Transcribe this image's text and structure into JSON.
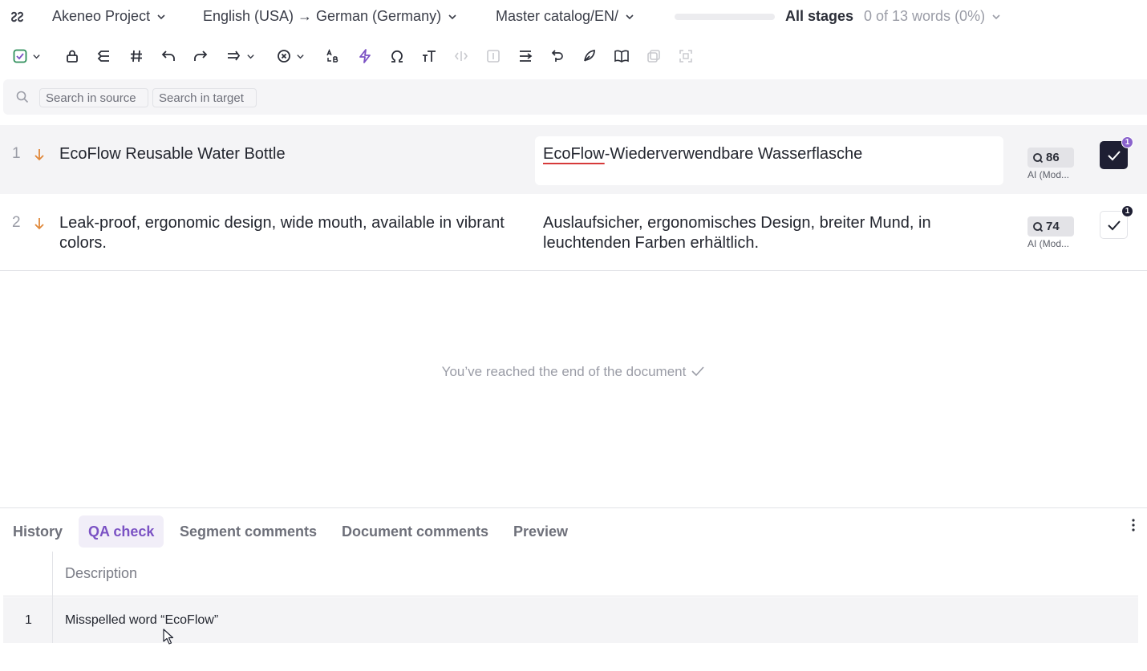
{
  "header": {
    "project": "Akeneo Project",
    "language_pair": "English (USA) → German (Germany)",
    "catalog": "Master catalog/EN/",
    "stages": "All stages",
    "word_progress": "0 of 13 words (0%)",
    "progress_fraction": 0
  },
  "search": {
    "source_placeholder": "Search in source",
    "target_placeholder": "Search in target"
  },
  "segments": [
    {
      "number": "1",
      "source": "EcoFlow Reusable Water Bottle",
      "target_misspelled": "EcoFlow",
      "target_rest": "-Wiederverwendbare Wasserflasche",
      "score": "86",
      "origin": "AI (Mod...",
      "confirmed": true,
      "badge": "1"
    },
    {
      "number": "2",
      "source": "Leak-proof, ergonomic design, wide mouth, available in vibrant colors.",
      "target": "Auslaufsicher, ergonomisches Design, breiter Mund, in leuchtenden Farben erhältlich.",
      "score": "74",
      "origin": "AI (Mod...",
      "confirmed": false,
      "badge": "1"
    }
  ],
  "end_message": "You’ve reached the end of the document",
  "panel": {
    "tabs": [
      {
        "label": "History",
        "active": false
      },
      {
        "label": "QA check",
        "active": true
      },
      {
        "label": "Segment comments",
        "active": false
      },
      {
        "label": "Document comments",
        "active": false
      },
      {
        "label": "Preview",
        "active": false
      }
    ],
    "qa_header": "Description",
    "qa_rows": [
      {
        "number": "1",
        "description": "Misspelled word “EcoFlow”"
      }
    ]
  },
  "colors": {
    "accent": "#7b52c4",
    "confirm_dark": "#1e1f33",
    "arrow_orange": "#e0883a",
    "spell_red": "#d63a3a"
  },
  "icons": {
    "toolbar": [
      "confirm-icon",
      "lock-icon",
      "split-icon",
      "hash-icon",
      "undo-icon",
      "redo-icon",
      "copy-source-icon",
      "clear-icon",
      "case-icon",
      "lightning-icon",
      "omega-icon",
      "text-size-icon",
      "tag-icon",
      "info-icon",
      "join-icon",
      "revert-icon",
      "feather-icon",
      "book-icon",
      "duplicate-icon",
      "expand-icon"
    ]
  }
}
